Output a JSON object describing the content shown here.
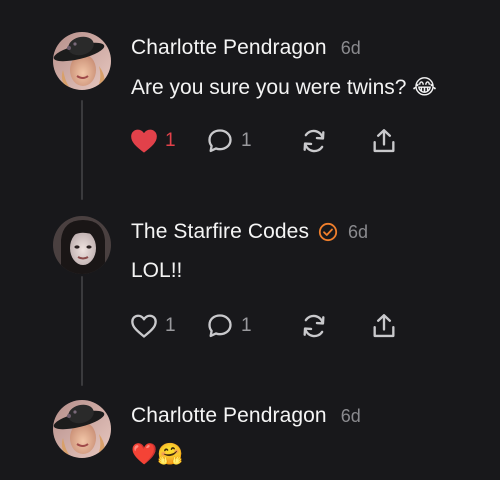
{
  "colors": {
    "background": "#18181b",
    "like_active": "#e2414a",
    "verified_badge": "#f07f2c",
    "muted": "#8a8a8e"
  },
  "comments": [
    {
      "author": "Charlotte Pendragon",
      "time": "6d",
      "verified": false,
      "text": "Are you sure you were twins? 😂",
      "liked": true,
      "like_count": "1",
      "reply_count": "1",
      "avatar": "avatar-photo-woman-hat"
    },
    {
      "author": "The Starfire Codes",
      "time": "6d",
      "verified": true,
      "text": "LOL!!",
      "liked": false,
      "like_count": "1",
      "reply_count": "1",
      "avatar": "avatar-photo-woman-dark-hair"
    },
    {
      "author": "Charlotte Pendragon",
      "time": "6d",
      "verified": false,
      "text": "❤️🤗",
      "avatar": "avatar-photo-woman-hat"
    }
  ]
}
